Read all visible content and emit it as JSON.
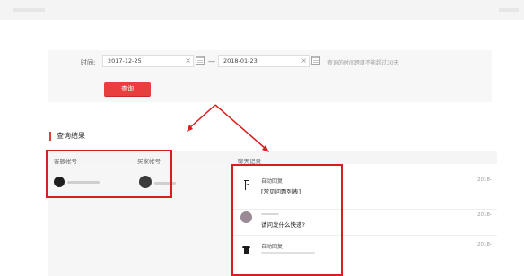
{
  "filter": {
    "time_label": "时间:",
    "start_date": "2017-12-25",
    "end_date": "2018-01-23",
    "separator": "—",
    "hint": "查询的时间跨度不能超过30天",
    "query_button": "查询",
    "clear_glyph": "×"
  },
  "results": {
    "title": "查询结果",
    "col_service": "客服帐号",
    "col_buyer": "买家帐号",
    "col_chat": "聊天记录"
  },
  "messages": [
    {
      "sender": "自动回复",
      "text": "[常见问题列表]",
      "time": "2018-"
    },
    {
      "sender": "",
      "text": "请问发什么快递?",
      "time": "2018-"
    },
    {
      "sender": "自动回复",
      "text": "",
      "time": "2018-"
    }
  ],
  "colors": {
    "accent": "#e83e3e",
    "highlight_box": "#d81f1f"
  }
}
